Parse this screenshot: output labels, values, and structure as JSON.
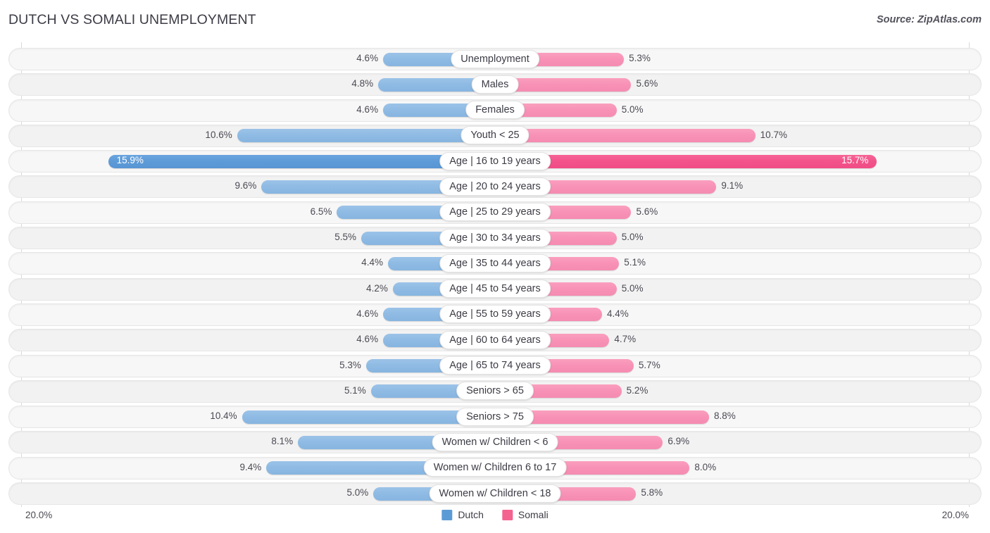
{
  "header": {
    "title": "DUTCH VS SOMALI UNEMPLOYMENT",
    "source": "Source: ZipAtlas.com"
  },
  "axis": {
    "left_max_label": "20.0%",
    "right_max_label": "20.0%",
    "max_value": 20.0
  },
  "legend": {
    "items": [
      {
        "label": "Dutch",
        "color": "#5b9bd5"
      },
      {
        "label": "Somali",
        "color": "#f4628f"
      }
    ]
  },
  "colors": {
    "dutch": "#8fbbe4",
    "dutch_strong": "#5e9bd8",
    "somali": "#f892b6",
    "somali_strong": "#f3548b",
    "track": "#f7f7f7",
    "text": "#3c3c46"
  },
  "chart_data": {
    "type": "bar",
    "orientation": "horizontal-diverging",
    "title": "DUTCH VS SOMALI UNEMPLOYMENT",
    "xlabel": "",
    "ylabel": "",
    "xlim": [
      0,
      20.0
    ],
    "grid": true,
    "legend_position": "bottom-center",
    "categories": [
      "Unemployment",
      "Males",
      "Females",
      "Youth < 25",
      "Age | 16 to 19 years",
      "Age | 20 to 24 years",
      "Age | 25 to 29 years",
      "Age | 30 to 34 years",
      "Age | 35 to 44 years",
      "Age | 45 to 54 years",
      "Age | 55 to 59 years",
      "Age | 60 to 64 years",
      "Age | 65 to 74 years",
      "Seniors > 65",
      "Seniors > 75",
      "Women w/ Children < 6",
      "Women w/ Children 6 to 17",
      "Women w/ Children < 18"
    ],
    "series": [
      {
        "name": "Dutch",
        "color": "#8fbbe4",
        "values": [
          4.6,
          4.8,
          4.6,
          10.6,
          15.9,
          9.6,
          6.5,
          5.5,
          4.4,
          4.2,
          4.6,
          4.6,
          5.3,
          5.1,
          10.4,
          8.1,
          9.4,
          5.0
        ],
        "labels": [
          "4.6%",
          "4.8%",
          "4.6%",
          "10.6%",
          "15.9%",
          "9.6%",
          "6.5%",
          "5.5%",
          "4.4%",
          "4.2%",
          "4.6%",
          "4.6%",
          "5.3%",
          "5.1%",
          "10.4%",
          "8.1%",
          "9.4%",
          "5.0%"
        ]
      },
      {
        "name": "Somali",
        "color": "#f892b6",
        "values": [
          5.3,
          5.6,
          5.0,
          10.7,
          15.7,
          9.1,
          5.6,
          5.0,
          5.1,
          5.0,
          4.4,
          4.7,
          5.7,
          5.2,
          8.8,
          6.9,
          8.0,
          5.8
        ],
        "labels": [
          "5.3%",
          "5.6%",
          "5.0%",
          "10.7%",
          "15.7%",
          "9.1%",
          "5.6%",
          "5.0%",
          "5.1%",
          "5.0%",
          "4.4%",
          "4.7%",
          "5.7%",
          "5.2%",
          "8.8%",
          "6.9%",
          "8.0%",
          "5.8%"
        ]
      }
    ]
  },
  "rows": [
    {
      "label": "Unemployment",
      "left_value": 4.6,
      "left_label": "4.6%",
      "right_value": 5.3,
      "right_label": "5.3%",
      "highlight": false
    },
    {
      "label": "Males",
      "left_value": 4.8,
      "left_label": "4.8%",
      "right_value": 5.6,
      "right_label": "5.6%",
      "highlight": false
    },
    {
      "label": "Females",
      "left_value": 4.6,
      "left_label": "4.6%",
      "right_value": 5.0,
      "right_label": "5.0%",
      "highlight": false
    },
    {
      "label": "Youth < 25",
      "left_value": 10.6,
      "left_label": "10.6%",
      "right_value": 10.7,
      "right_label": "10.7%",
      "highlight": false
    },
    {
      "label": "Age | 16 to 19 years",
      "left_value": 15.9,
      "left_label": "15.9%",
      "right_value": 15.7,
      "right_label": "15.7%",
      "highlight": true
    },
    {
      "label": "Age | 20 to 24 years",
      "left_value": 9.6,
      "left_label": "9.6%",
      "right_value": 9.1,
      "right_label": "9.1%",
      "highlight": false
    },
    {
      "label": "Age | 25 to 29 years",
      "left_value": 6.5,
      "left_label": "6.5%",
      "right_value": 5.6,
      "right_label": "5.6%",
      "highlight": false
    },
    {
      "label": "Age | 30 to 34 years",
      "left_value": 5.5,
      "left_label": "5.5%",
      "right_value": 5.0,
      "right_label": "5.0%",
      "highlight": false
    },
    {
      "label": "Age | 35 to 44 years",
      "left_value": 4.4,
      "left_label": "4.4%",
      "right_value": 5.1,
      "right_label": "5.1%",
      "highlight": false
    },
    {
      "label": "Age | 45 to 54 years",
      "left_value": 4.2,
      "left_label": "4.2%",
      "right_value": 5.0,
      "right_label": "5.0%",
      "highlight": false
    },
    {
      "label": "Age | 55 to 59 years",
      "left_value": 4.6,
      "left_label": "4.6%",
      "right_value": 4.4,
      "right_label": "4.4%",
      "highlight": false
    },
    {
      "label": "Age | 60 to 64 years",
      "left_value": 4.6,
      "left_label": "4.6%",
      "right_value": 4.7,
      "right_label": "4.7%",
      "highlight": false
    },
    {
      "label": "Age | 65 to 74 years",
      "left_value": 5.3,
      "left_label": "5.3%",
      "right_value": 5.7,
      "right_label": "5.7%",
      "highlight": false
    },
    {
      "label": "Seniors > 65",
      "left_value": 5.1,
      "left_label": "5.1%",
      "right_value": 5.2,
      "right_label": "5.2%",
      "highlight": false
    },
    {
      "label": "Seniors > 75",
      "left_value": 10.4,
      "left_label": "10.4%",
      "right_value": 8.8,
      "right_label": "8.8%",
      "highlight": false
    },
    {
      "label": "Women w/ Children < 6",
      "left_value": 8.1,
      "left_label": "8.1%",
      "right_value": 6.9,
      "right_label": "6.9%",
      "highlight": false
    },
    {
      "label": "Women w/ Children 6 to 17",
      "left_value": 9.4,
      "left_label": "9.4%",
      "right_value": 8.0,
      "right_label": "8.0%",
      "highlight": false
    },
    {
      "label": "Women w/ Children < 18",
      "left_value": 5.0,
      "left_label": "5.0%",
      "right_value": 5.8,
      "right_label": "5.8%",
      "highlight": false
    }
  ]
}
